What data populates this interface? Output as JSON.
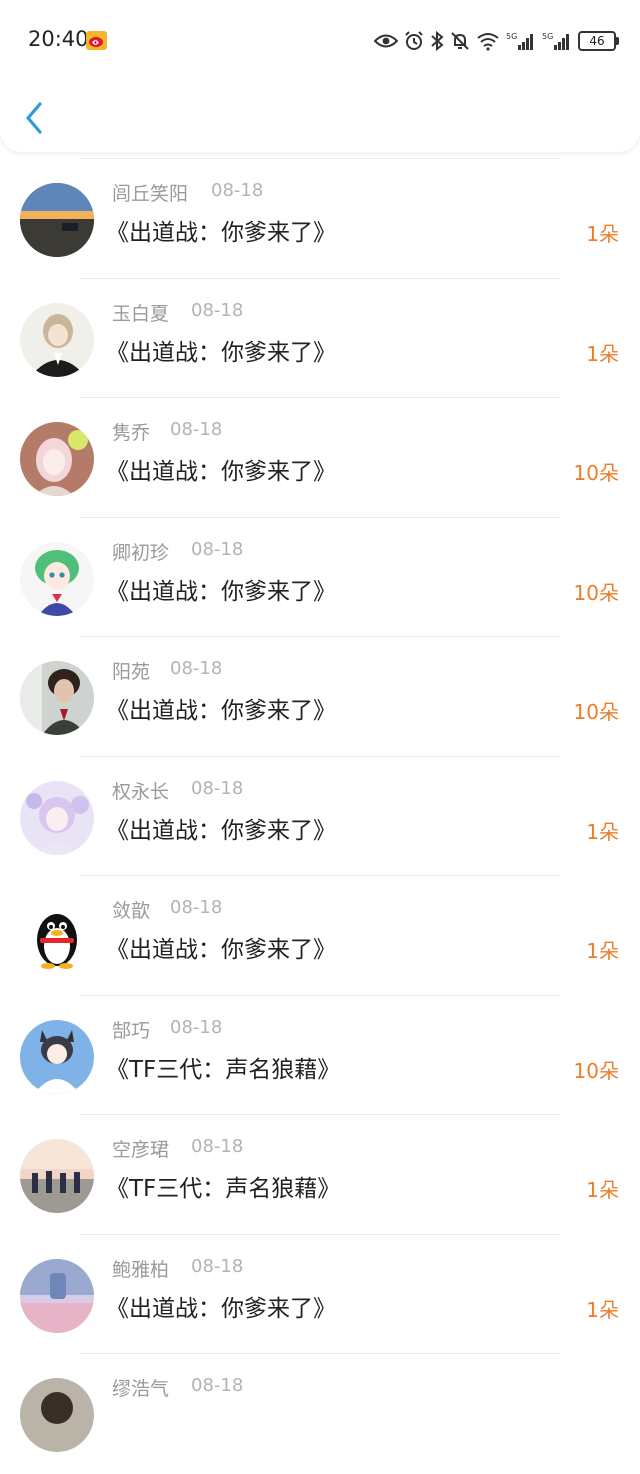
{
  "status_bar": {
    "time": "20:40",
    "battery": "46",
    "icons": [
      "weibo-icon",
      "eye-icon",
      "alarm-icon",
      "bluetooth-icon",
      "mute-icon",
      "wifi-icon",
      "signal-5g-icon",
      "signal-5g-icon-2",
      "battery-icon"
    ]
  },
  "colors": {
    "accent": "#2d9cdb",
    "count": "#f07c2a",
    "name": "#9a9a9a",
    "date": "#b3b3b3",
    "title": "#222222"
  },
  "records": [
    {
      "name": "",
      "date": "",
      "title": "",
      "count": "",
      "avatar": "pink-avatar"
    },
    {
      "name": "闾丘笑阳",
      "date": "08-18",
      "title": "《出道战：你爹来了》",
      "count": "1朵",
      "avatar": "sunset-avatar"
    },
    {
      "name": "玉白夏",
      "date": "08-18",
      "title": "《出道战：你爹来了》",
      "count": "1朵",
      "avatar": "anime-boy-avatar"
    },
    {
      "name": "隽乔",
      "date": "08-18",
      "title": "《出道战：你爹来了》",
      "count": "10朵",
      "avatar": "anime-girl-avatar"
    },
    {
      "name": "卿初珍",
      "date": "08-18",
      "title": "《出道战：你爹来了》",
      "count": "10朵",
      "avatar": "green-hair-avatar"
    },
    {
      "name": "阳苑",
      "date": "08-18",
      "title": "《出道战：你爹来了》",
      "count": "10朵",
      "avatar": "photo-avatar"
    },
    {
      "name": "权永长",
      "date": "08-18",
      "title": "《出道战：你爹来了》",
      "count": "1朵",
      "avatar": "purple-anime-avatar"
    },
    {
      "name": "敛歆",
      "date": "08-18",
      "title": "《出道战：你爹来了》",
      "count": "1朵",
      "avatar": "qq-penguin-avatar"
    },
    {
      "name": "郜巧",
      "date": "08-18",
      "title": "《TF三代：声名狼藉》",
      "count": "10朵",
      "avatar": "cat-ear-avatar"
    },
    {
      "name": "空彦珺",
      "date": "08-18",
      "title": "《TF三代：声名狼藉》",
      "count": "1朵",
      "avatar": "group-photo-avatar"
    },
    {
      "name": "鲍雅柏",
      "date": "08-18",
      "title": "《出道战：你爹来了》",
      "count": "1朵",
      "avatar": "pink-sky-avatar"
    },
    {
      "name": "缪浩气",
      "date": "08-18",
      "title": "",
      "count": "",
      "avatar": "partial-avatar"
    }
  ]
}
